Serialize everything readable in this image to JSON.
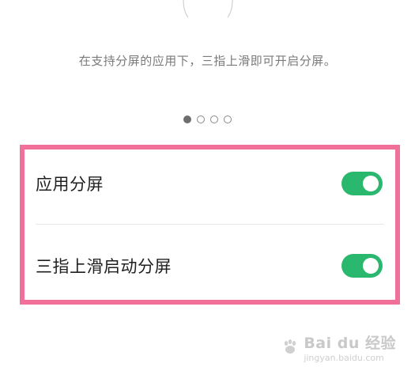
{
  "description": "在支持分屏的应用下，三指上滑即可开启分屏。",
  "pager": {
    "total": 4,
    "active_index": 0
  },
  "settings": [
    {
      "label": "应用分屏",
      "enabled": true
    },
    {
      "label": "三指上滑启动分屏",
      "enabled": true
    }
  ],
  "colors": {
    "toggle_on": "#29b86e",
    "highlight_border": "#f0709a",
    "description_text": "#7a7a7a"
  },
  "watermark": {
    "logo": "Bai du 经验",
    "site": "jingyan.baidu.com"
  }
}
